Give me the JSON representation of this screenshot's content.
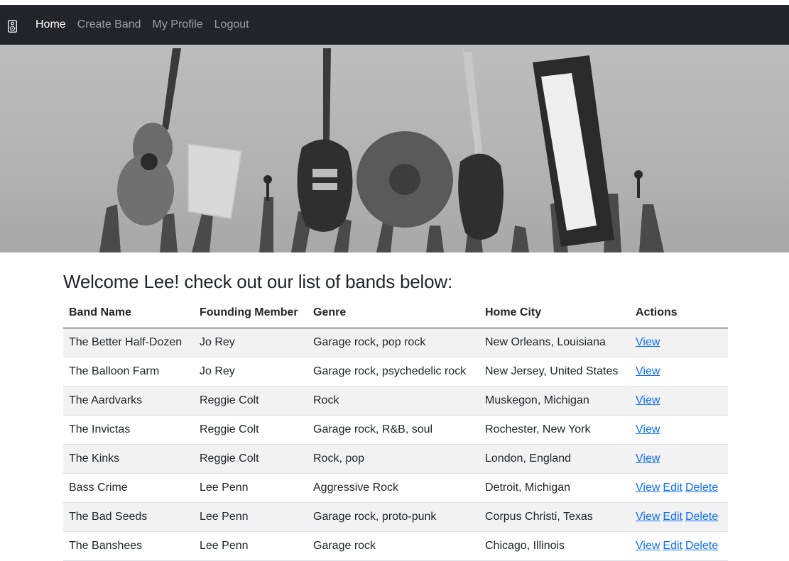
{
  "nav": {
    "brand_icon": "speaker-icon",
    "links": [
      {
        "label": "Home",
        "active": true
      },
      {
        "label": "Create Band",
        "active": false
      },
      {
        "label": "My Profile",
        "active": false
      },
      {
        "label": "Logout",
        "active": false
      }
    ]
  },
  "hero": {
    "image": "hands raising instruments (guitars, laptop, cymbal, bass, keyboard)"
  },
  "main": {
    "heading": "Welcome Lee! check out our list of bands below:",
    "table": {
      "headers": [
        "Band Name",
        "Founding Member",
        "Genre",
        "Home City",
        "Actions"
      ],
      "rows": [
        {
          "band": "The Better Half-Dozen",
          "member": "Jo Rey",
          "genre": "Garage rock, pop rock",
          "city": "New Orleans, Louisiana",
          "actions": [
            "View"
          ]
        },
        {
          "band": "The Balloon Farm",
          "member": "Jo Rey",
          "genre": "Garage rock, psychedelic rock",
          "city": "New Jersey, United States",
          "actions": [
            "View"
          ]
        },
        {
          "band": "The Aardvarks",
          "member": "Reggie Colt",
          "genre": "Rock",
          "city": "Muskegon, Michigan",
          "actions": [
            "View"
          ]
        },
        {
          "band": "The Invictas",
          "member": "Reggie Colt",
          "genre": "Garage rock, R&B, soul",
          "city": "Rochester, New York",
          "actions": [
            "View"
          ]
        },
        {
          "band": "The Kinks",
          "member": "Reggie Colt",
          "genre": "Rock, pop",
          "city": "London, England",
          "actions": [
            "View"
          ]
        },
        {
          "band": "Bass Crime",
          "member": "Lee Penn",
          "genre": "Aggressive Rock",
          "city": "Detroit, Michigan",
          "actions": [
            "View",
            "Edit",
            "Delete"
          ]
        },
        {
          "band": "The Bad Seeds",
          "member": "Lee Penn",
          "genre": "Garage rock, proto-punk",
          "city": "Corpus Christi, Texas",
          "actions": [
            "View",
            "Edit",
            "Delete"
          ]
        },
        {
          "band": "The Banshees",
          "member": "Lee Penn",
          "genre": "Garage rock",
          "city": "Chicago, Illinois",
          "actions": [
            "View",
            "Edit",
            "Delete"
          ]
        }
      ]
    }
  },
  "colors": {
    "navbar": "#212529",
    "link": "#0d6efd",
    "stripe": "#f2f2f2"
  }
}
